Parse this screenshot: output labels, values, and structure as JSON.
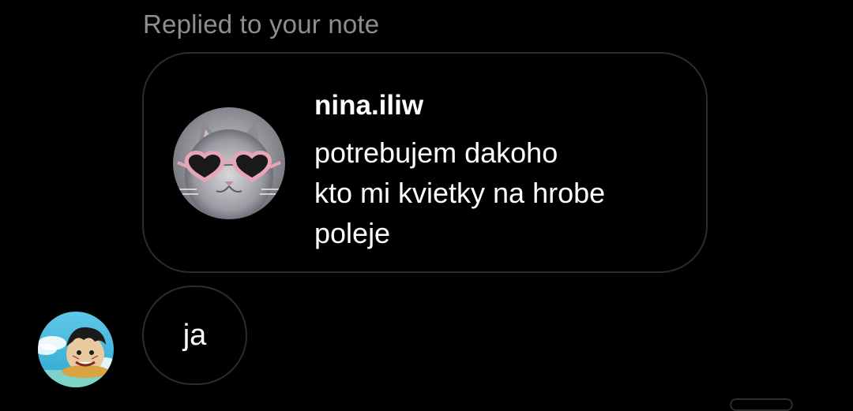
{
  "reply_context": {
    "label": "Replied to your note"
  },
  "note": {
    "username": "nina.iliw",
    "text": "potrebujem dakoho\nkto mi kvietky na hrobe\npoleje",
    "avatar_icon": "cat-with-heart-sunglasses-avatar"
  },
  "message": {
    "text": "ja",
    "sender_avatar_icon": "anime-character-avatar"
  },
  "colors": {
    "background": "#000000",
    "muted_text": "#8e8e8e",
    "border": "#2c2c2c",
    "text": "#ffffff"
  }
}
